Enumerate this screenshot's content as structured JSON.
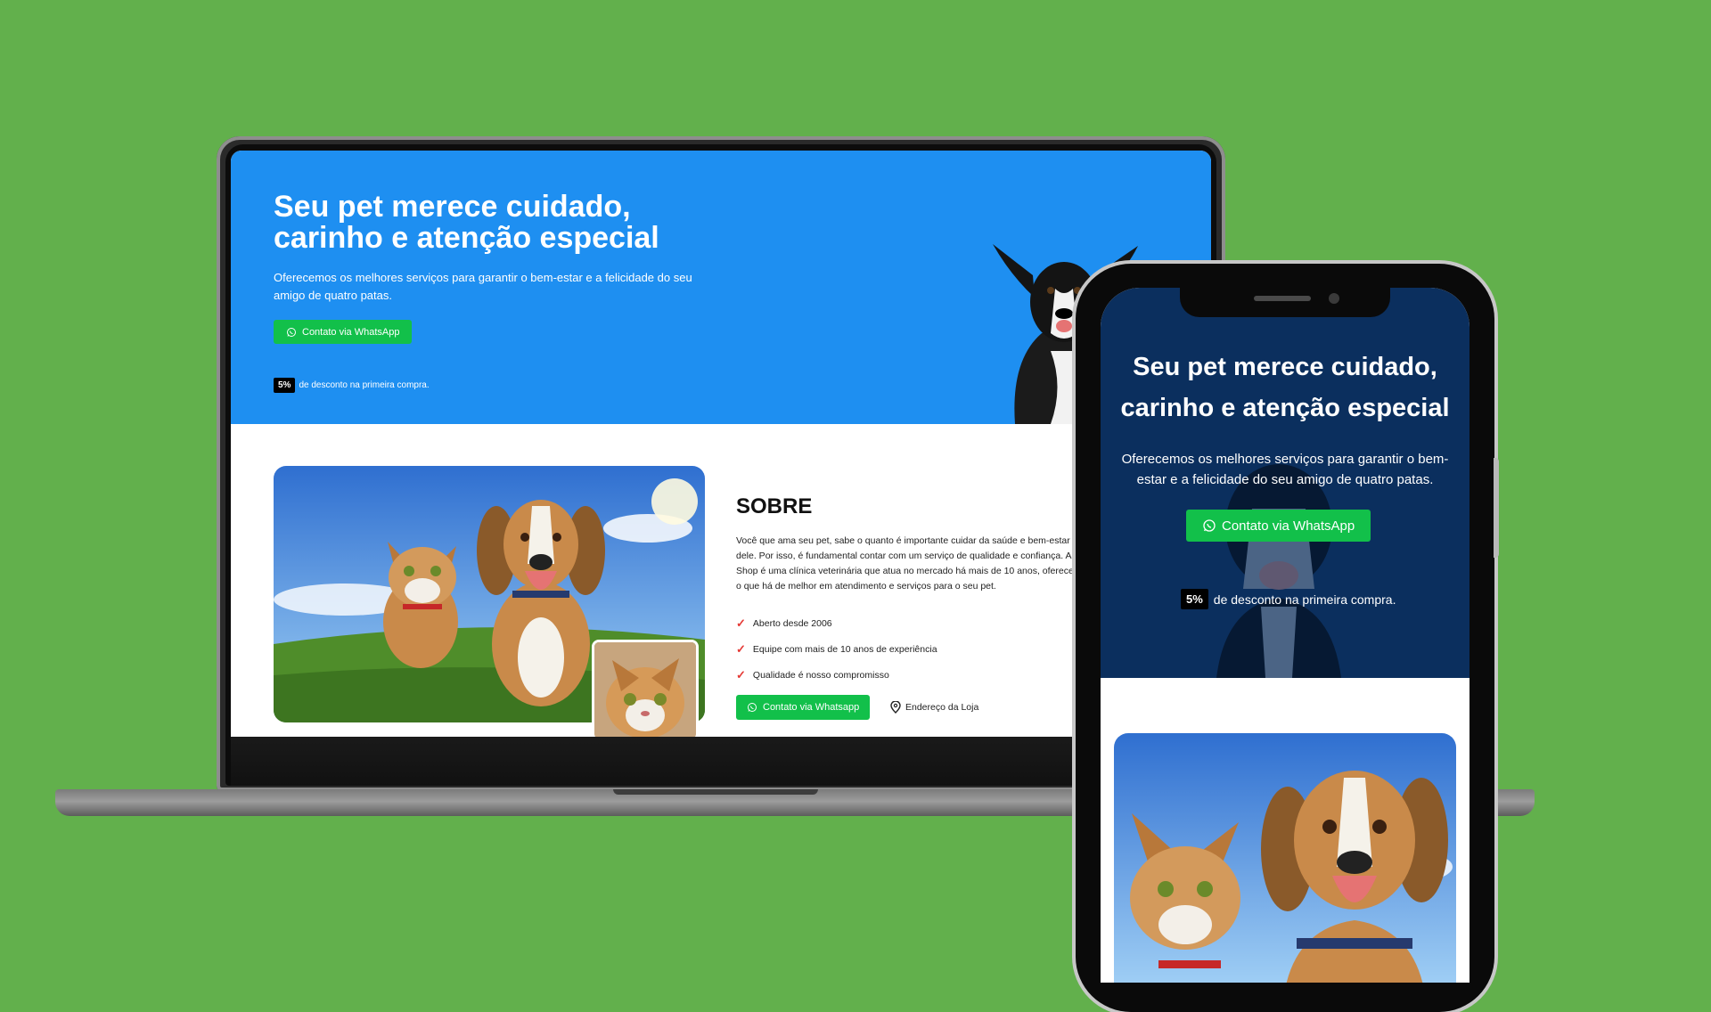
{
  "hero": {
    "title_line1": "Seu pet merece cuidado,",
    "title_line2": "carinho e atenção especial",
    "subtitle": "Oferecemos os melhores serviços para garantir o bem-estar e a felicidade do seu amigo de quatro patas.",
    "cta_label": "Contato via WhatsApp",
    "discount_badge": "5%",
    "discount_text": "de desconto na primeira compra."
  },
  "about": {
    "title": "SOBRE",
    "text": "Você que ama seu pet, sabe o quanto é importante cuidar da saúde e bem-estar dele. Por isso, é fundamental contar com um serviço de qualidade e confiança. A Pet Shop é uma clínica veterinária que atua no mercado há mais de 10 anos, oferecendo o que há de melhor em atendimento e serviços para o seu pet.",
    "features": [
      "Aberto desde 2006",
      "Equipe com mais de 10 anos de experiência",
      "Qualidade é nosso compromisso"
    ],
    "cta_label": "Contato via Whatsapp",
    "address_label": "Endereço da Loja"
  },
  "colors": {
    "background": "#62b04c",
    "hero_desktop": "#1e8ff1",
    "hero_mobile": "#0b2f5e",
    "whatsapp_green": "#12c04a",
    "check_red": "#e53935"
  },
  "icons": [
    "whatsapp-icon",
    "check-icon",
    "location-pin-icon"
  ]
}
